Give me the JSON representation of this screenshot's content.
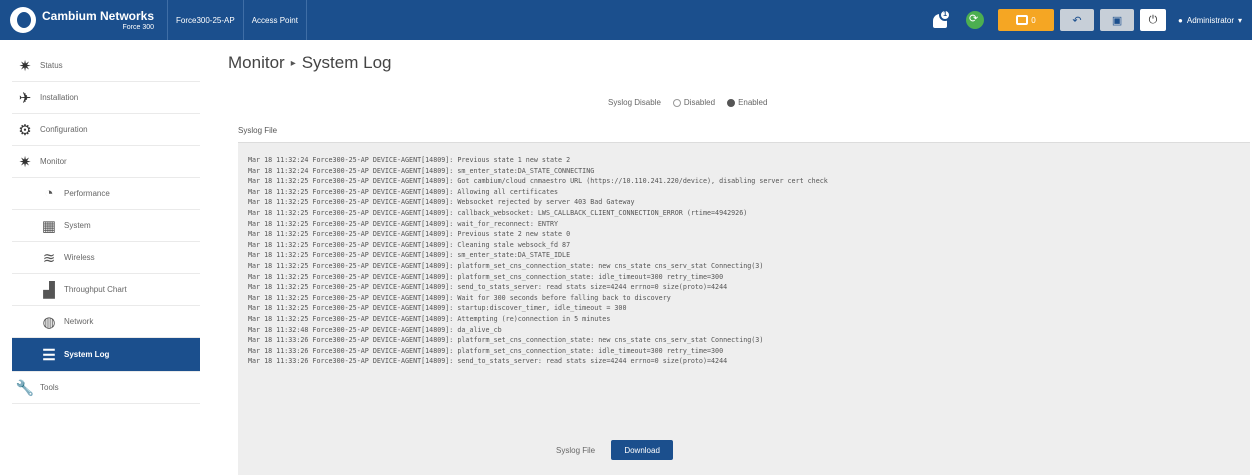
{
  "header": {
    "brand": "Cambium Networks",
    "brand_sub": "Force 300",
    "device_name": "Force300-25-AP",
    "access_point": "Access Point",
    "notification_count": "1",
    "alert_count": "0",
    "user": "Administrator"
  },
  "sidebar": {
    "items": [
      {
        "label": "Status",
        "icon": "status-icon"
      },
      {
        "label": "Installation",
        "icon": "installation-icon"
      },
      {
        "label": "Configuration",
        "icon": "gear-icon"
      },
      {
        "label": "Monitor",
        "icon": "monitor-icon"
      },
      {
        "label": "Performance",
        "icon": "performance-icon"
      },
      {
        "label": "System",
        "icon": "system-icon"
      },
      {
        "label": "Wireless",
        "icon": "wifi-icon"
      },
      {
        "label": "Throughput Chart",
        "icon": "chart-icon"
      },
      {
        "label": "Network",
        "icon": "globe-icon"
      },
      {
        "label": "System Log",
        "icon": "log-icon"
      },
      {
        "label": "Tools",
        "icon": "wrench-icon"
      }
    ]
  },
  "main": {
    "title": "Monitor",
    "subtitle": "System Log",
    "syslog_label": "Syslog Disable",
    "disabled_label": "Disabled",
    "enabled_label": "Enabled",
    "file_label": "Syslog File",
    "log_lines": [
      "Mar 18 11:32:24 Force300-25-AP DEVICE-AGENT[14809]: Previous state 1 new state 2",
      "Mar 18 11:32:24 Force300-25-AP DEVICE-AGENT[14809]: sm_enter_state:DA_STATE_CONNECTING",
      "Mar 18 11:32:25 Force300-25-AP DEVICE-AGENT[14809]: Got cambium/cloud cnmaestro URL (https://10.110.241.220/device), disabling server cert check",
      "Mar 18 11:32:25 Force300-25-AP DEVICE-AGENT[14809]: Allowing all certificates",
      "Mar 18 11:32:25 Force300-25-AP DEVICE-AGENT[14809]: Websocket rejected by server 403 Bad Gateway",
      "Mar 18 11:32:25 Force300-25-AP DEVICE-AGENT[14809]: callback_websocket: LWS_CALLBACK_CLIENT_CONNECTION_ERROR (rtime=4942926)",
      "Mar 18 11:32:25 Force300-25-AP DEVICE-AGENT[14809]: wait_for_reconnect: ENTRY",
      "Mar 18 11:32:25 Force300-25-AP DEVICE-AGENT[14809]: Previous state 2 new state 0",
      "Mar 18 11:32:25 Force300-25-AP DEVICE-AGENT[14809]: Cleaning stale websock_fd 87",
      "Mar 18 11:32:25 Force300-25-AP DEVICE-AGENT[14809]: sm_enter_state:DA_STATE_IDLE",
      "Mar 18 11:32:25 Force300-25-AP DEVICE-AGENT[14809]: platform_set_cns_connection_state: new cns_state cns_serv_stat Connecting(3)",
      "Mar 18 11:32:25 Force300-25-AP DEVICE-AGENT[14809]: platform_set_cns_connection_state: idle_timeout=300 retry_time=300",
      "Mar 18 11:32:25 Force300-25-AP DEVICE-AGENT[14809]: send_to_stats_server: read stats size=4244 errno=0 size(proto)=4244",
      "Mar 18 11:32:25 Force300-25-AP DEVICE-AGENT[14809]: Wait for 300 seconds before falling back to discovery",
      "Mar 18 11:32:25 Force300-25-AP DEVICE-AGENT[14809]: startup:discover_timer, idle_timeout = 300",
      "Mar 18 11:32:25 Force300-25-AP DEVICE-AGENT[14809]: Attempting (re)connection in 5 minutes",
      "Mar 18 11:32:48 Force300-25-AP DEVICE-AGENT[14809]: da_alive_cb",
      "Mar 18 11:33:26 Force300-25-AP DEVICE-AGENT[14809]: platform_set_cns_connection_state: new cns_state cns_serv_stat Connecting(3)",
      "Mar 18 11:33:26 Force300-25-AP DEVICE-AGENT[14809]: platform_set_cns_connection_state: idle_timeout=300 retry_time=300",
      "Mar 18 11:33:26 Force300-25-AP DEVICE-AGENT[14809]: send_to_stats_server: read stats size=4244 errno=0 size(proto)=4244"
    ],
    "download_label": "Syslog File",
    "download_button": "Download"
  }
}
